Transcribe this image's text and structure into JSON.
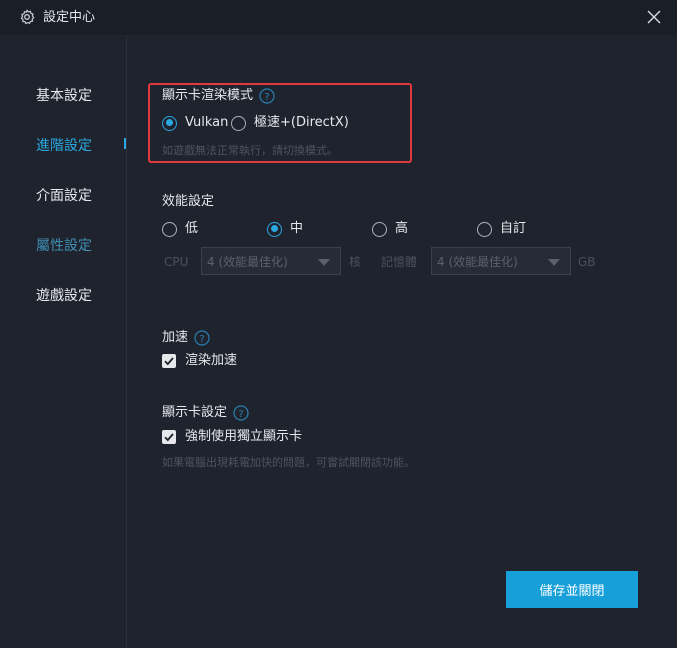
{
  "window": {
    "title": "設定中心"
  },
  "sidebar": {
    "items": [
      {
        "label": "基本設定",
        "state": "normal"
      },
      {
        "label": "進階設定",
        "state": "active"
      },
      {
        "label": "介面設定",
        "state": "normal"
      },
      {
        "label": "屬性設定",
        "state": "dim"
      },
      {
        "label": "遊戲設定",
        "state": "normal"
      }
    ]
  },
  "graphics_mode": {
    "title": "顯示卡渲染模式",
    "options": [
      "Vulkan",
      "極速+(DirectX)"
    ],
    "selected": "Vulkan",
    "hint": "如遊戲無法正常執行，請切換模式。"
  },
  "performance": {
    "title": "效能設定",
    "options": [
      "低",
      "中",
      "高",
      "自訂"
    ],
    "selected": "中",
    "cpu_label": "CPU",
    "cpu_value": "4 (效能最佳化)",
    "cpu_unit": "核",
    "memory_label": "記憶體",
    "memory_value": "4 (效能最佳化)",
    "memory_unit": "GB"
  },
  "acceleration": {
    "title": "加速",
    "checkbox_label": "渲染加速",
    "checked": true
  },
  "gpu": {
    "title": "顯示卡設定",
    "checkbox_label": "強制使用獨立顯示卡",
    "checked": true,
    "hint": "如果電腦出現耗電加快的問題，可嘗試關閉該功能。"
  },
  "footer": {
    "save_label": "儲存並關閉"
  },
  "colors": {
    "accent": "#2aa8e0",
    "button": "#169fd8",
    "highlight": "#e03a3e",
    "background": "#1f232e"
  }
}
